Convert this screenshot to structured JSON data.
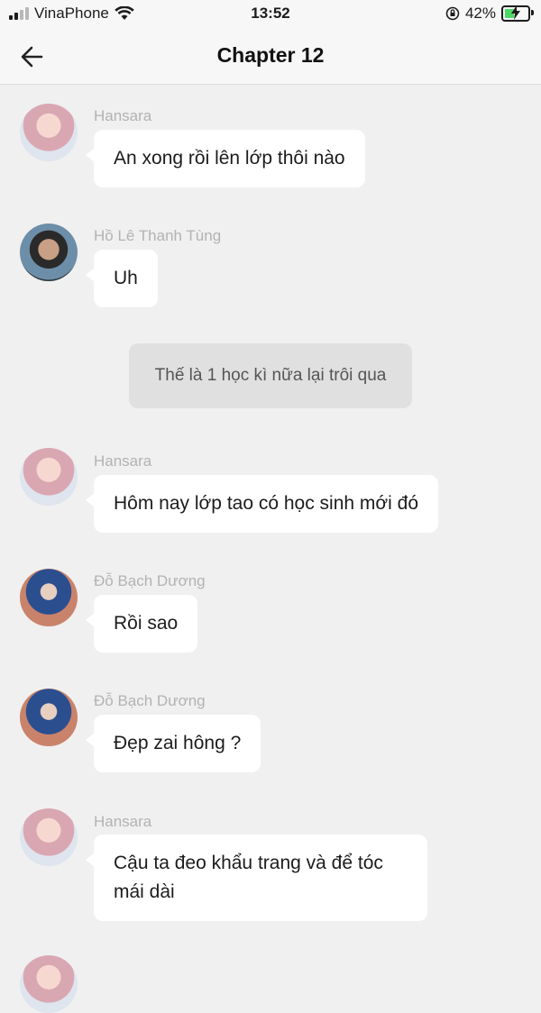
{
  "status_bar": {
    "carrier": "VinaPhone",
    "time": "13:52",
    "battery_percent": "42%",
    "battery_level": 0.42,
    "battery_fill_color": "#4cd964"
  },
  "header": {
    "title": "Chapter 12",
    "back_icon": "arrow-left-icon"
  },
  "messages": [
    {
      "sender": "Hansara",
      "text": "An xong rồi lên lớp thôi nào"
    },
    {
      "sender": "Hồ Lê Thanh Tùng",
      "text": "Uh"
    },
    {
      "system": "Thế là 1 học kì nữa lại trôi qua"
    },
    {
      "sender": "Hansara",
      "text": "Hôm nay lớp tao có học sinh mới đó"
    },
    {
      "sender": "Đỗ Bạch Dương",
      "text": "Rồi sao"
    },
    {
      "sender": "Đỗ Bạch Dương",
      "text": "Đẹp zai hông ?"
    },
    {
      "sender": "Hansara",
      "text": "Cậu ta đeo khẩu trang và để tóc mái dài"
    }
  ]
}
